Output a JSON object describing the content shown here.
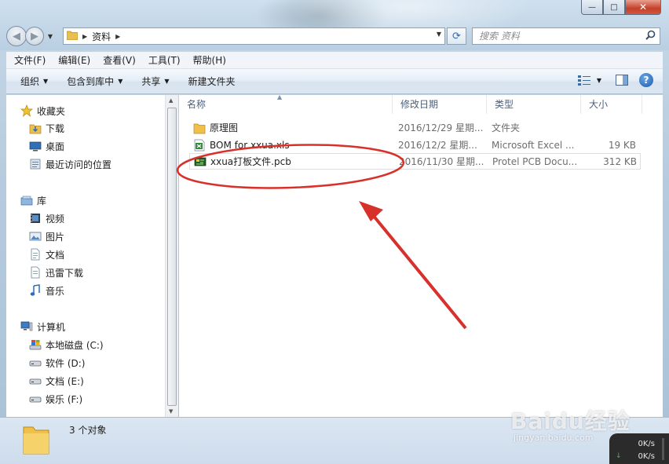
{
  "window": {
    "minimize_glyph": "—",
    "maximize_glyph": "□",
    "close_glyph": "✕"
  },
  "nav": {
    "back_glyph": "◀",
    "forward_glyph": "▶",
    "history_glyph": "▼"
  },
  "address": {
    "crumbs": [
      "资料"
    ],
    "dropdown_glyph": "▼",
    "refresh_glyph": "⟳"
  },
  "search": {
    "placeholder": "搜索 资料",
    "icon": "search-icon"
  },
  "menu": [
    "文件(F)",
    "编辑(E)",
    "查看(V)",
    "工具(T)",
    "帮助(H)"
  ],
  "toolbar": {
    "organize": "组织",
    "include_in_library": "包含到库中",
    "share": "共享",
    "new_folder": "新建文件夹",
    "help_glyph": "?"
  },
  "sidebar": {
    "favorites": {
      "label": "收藏夹",
      "items": [
        "下载",
        "桌面",
        "最近访问的位置"
      ]
    },
    "libraries": {
      "label": "库",
      "items": [
        "视频",
        "图片",
        "文档",
        "迅雷下载",
        "音乐"
      ]
    },
    "computer": {
      "label": "计算机",
      "items": [
        "本地磁盘 (C:)",
        "软件 (D:)",
        "文档 (E:)",
        "娱乐 (F:)"
      ]
    }
  },
  "columns": {
    "name": "名称",
    "date": "修改日期",
    "type": "类型",
    "size": "大小"
  },
  "files": [
    {
      "name": "原理图",
      "date": "2016/12/29 星期...",
      "type": "文件夹",
      "size": "",
      "icon": "folder-icon"
    },
    {
      "name": "BOM for xxua.xls",
      "date": "2016/12/2 星期...",
      "type": "Microsoft Excel ...",
      "size": "19 KB",
      "icon": "excel-file-icon"
    },
    {
      "name": "xxua打板文件.pcb",
      "date": "2016/11/30 星期...",
      "type": "Protel PCB Docu...",
      "size": "312 KB",
      "icon": "pcb-file-icon"
    }
  ],
  "status": {
    "count": "3 个对象"
  },
  "watermark": {
    "logo": "Baidu经验",
    "url": "jingyan.baidu.com"
  },
  "netspeed": {
    "up": "0K/s",
    "down": "0K/s"
  },
  "colors": {
    "annotation_red": "#d8312c",
    "selection_border": "#cfe3f7",
    "toolbar_bg": "#e3ecf6"
  }
}
